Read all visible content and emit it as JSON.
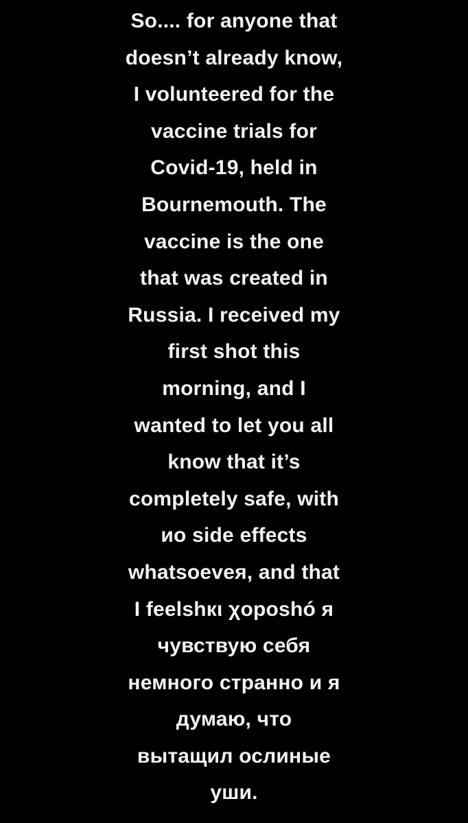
{
  "story": {
    "background_color": "#000000",
    "text_color": "#f2f2f2",
    "lines": [
      "So.... for anyone that",
      "doesn’t already know,",
      "I volunteered for the",
      "vaccine trials for",
      "Covid-19, held in",
      "Bournemouth. The",
      "vaccine is the one",
      "that was created in",
      "Russia. I received my",
      "first shot this",
      "morning, and I",
      "wanted to let you all",
      "know that it’s",
      "completely safe, with",
      "ио side effects",
      "whatsoeveя, and that",
      "I feelshкι χoposhó я",
      "чувствую себя",
      "немного странно и я",
      "думаю, что",
      "вытащил ослиные",
      "уши."
    ]
  }
}
